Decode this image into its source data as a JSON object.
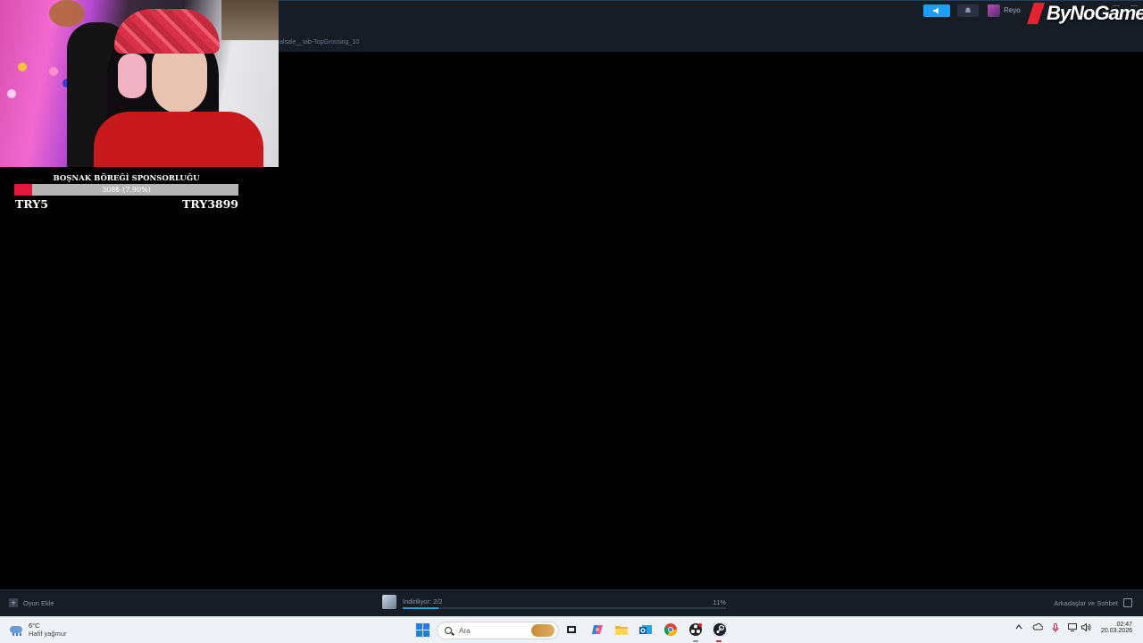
{
  "steam": {
    "url_fragment": "alsale__tab-TopGrossing_10",
    "user_name": "Reyo",
    "add_game_label": "Oyun Ekle",
    "download_label": "İndiriliyor: 2/2",
    "download_percent_label": "11%",
    "download_progress": 0.11,
    "friends_label": "Arkadaşlar ve Sohbet"
  },
  "sponsor": {
    "logo_text": "ByNoGame"
  },
  "donation_goal": {
    "title": "BOŞNAK BÖREĞİ SPONSORLUĞU",
    "progress_text": "308₺ (7.90%)",
    "progress": 0.079,
    "min_label": "TRY5",
    "max_label": "TRY3899",
    "fill_color": "#e2183f"
  },
  "taskbar": {
    "weather_temp": "6°C",
    "weather_desc": "Hafif yağmur",
    "search_placeholder": "Ara",
    "time": "02:47",
    "date": "20.03.2026",
    "pinned": [
      "start-icon",
      "search-icon",
      "task-view-icon",
      "copilot-icon",
      "file-explorer-icon",
      "outlook-icon",
      "chrome-icon",
      "obs-icon",
      "steam-icon"
    ]
  },
  "colors": {
    "steam_accent": "#1a9fff",
    "steam_bg": "#171d25"
  }
}
